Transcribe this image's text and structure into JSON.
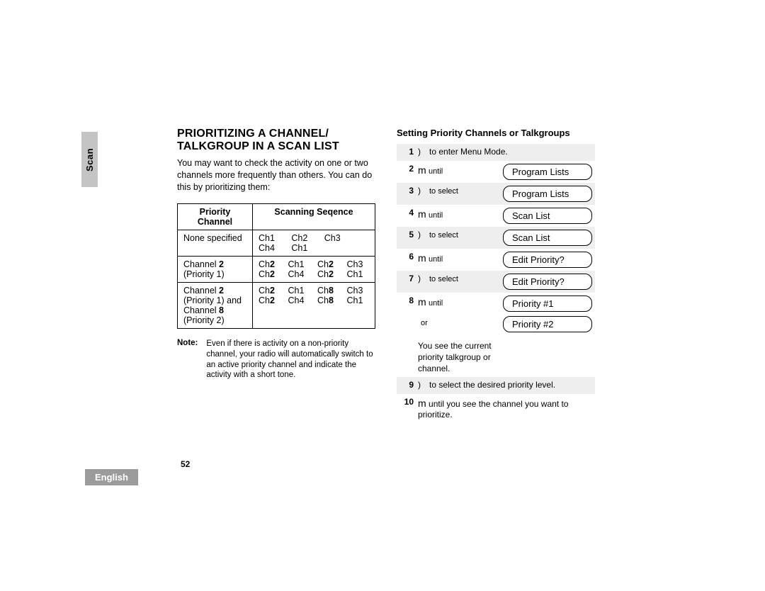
{
  "sidebar": {
    "scan_label": "Scan"
  },
  "left": {
    "title1": "PRIORITIZING A CHANNEL/",
    "title2": "TALKGROUP IN A SCAN LIST",
    "intro": "You may want to check the activity on one or two channels more frequently than others.  You can do this by prioritizing them:",
    "table": {
      "head_priority": "Priority Channel",
      "head_sequence": "Scanning Seqence",
      "rows": [
        {
          "label_l1": "None specified",
          "label_l2": "",
          "label_l3": "",
          "seq": [
            "Ch1",
            "Ch2",
            "Ch3",
            "",
            "Ch4",
            "Ch1",
            "",
            ""
          ]
        },
        {
          "label_l1": "Channel ",
          "label_l1b": "2",
          "label_l2": "(Priority 1)",
          "label_l3": "",
          "seq": [
            "Ch<b>2</b>",
            "Ch1",
            "Ch<b>2</b>",
            "Ch3",
            "Ch<b>2</b>",
            "Ch4",
            "Ch<b>2</b>",
            "Ch1"
          ]
        },
        {
          "label_l1": "Channel ",
          "label_l1b": "2",
          "label_l2": "(Priority 1) and",
          "label_l3": "Channel ",
          "label_l3b": "8",
          "label_l4": "(Priority 2)",
          "seq": [
            "Ch<b>2</b>",
            "Ch1",
            "Ch<b>8</b>",
            "Ch3",
            "Ch<b>2</b>",
            "Ch4",
            "Ch<b>8</b>",
            "Ch1"
          ]
        }
      ]
    },
    "note_label": "Note:",
    "note_text": "Even if there is activity on a non-priority channel, your radio will automatically switch to an active priority channel and indicate the activity with a short tone."
  },
  "right": {
    "subhead": "Setting Priority Channels or Talkgroups",
    "step1_text": "to enter Menu Mode.",
    "until": "until",
    "to_select": "to select",
    "or": "or",
    "pill_program_lists": "Program Lists",
    "pill_scan_list": "Scan List",
    "pill_edit_priority": "Edit Priority?",
    "pill_priority1": "Priority #1",
    "pill_priority2": "Priority #2",
    "step8_note": "You see the current priority talkgroup or channel.",
    "step9_text": "to select the desired priority level.",
    "step10_text_a": "until you see the channel you want to prioritize.",
    "paren": ")",
    "m": "m"
  },
  "footer": {
    "page": "52",
    "lang": "English"
  }
}
